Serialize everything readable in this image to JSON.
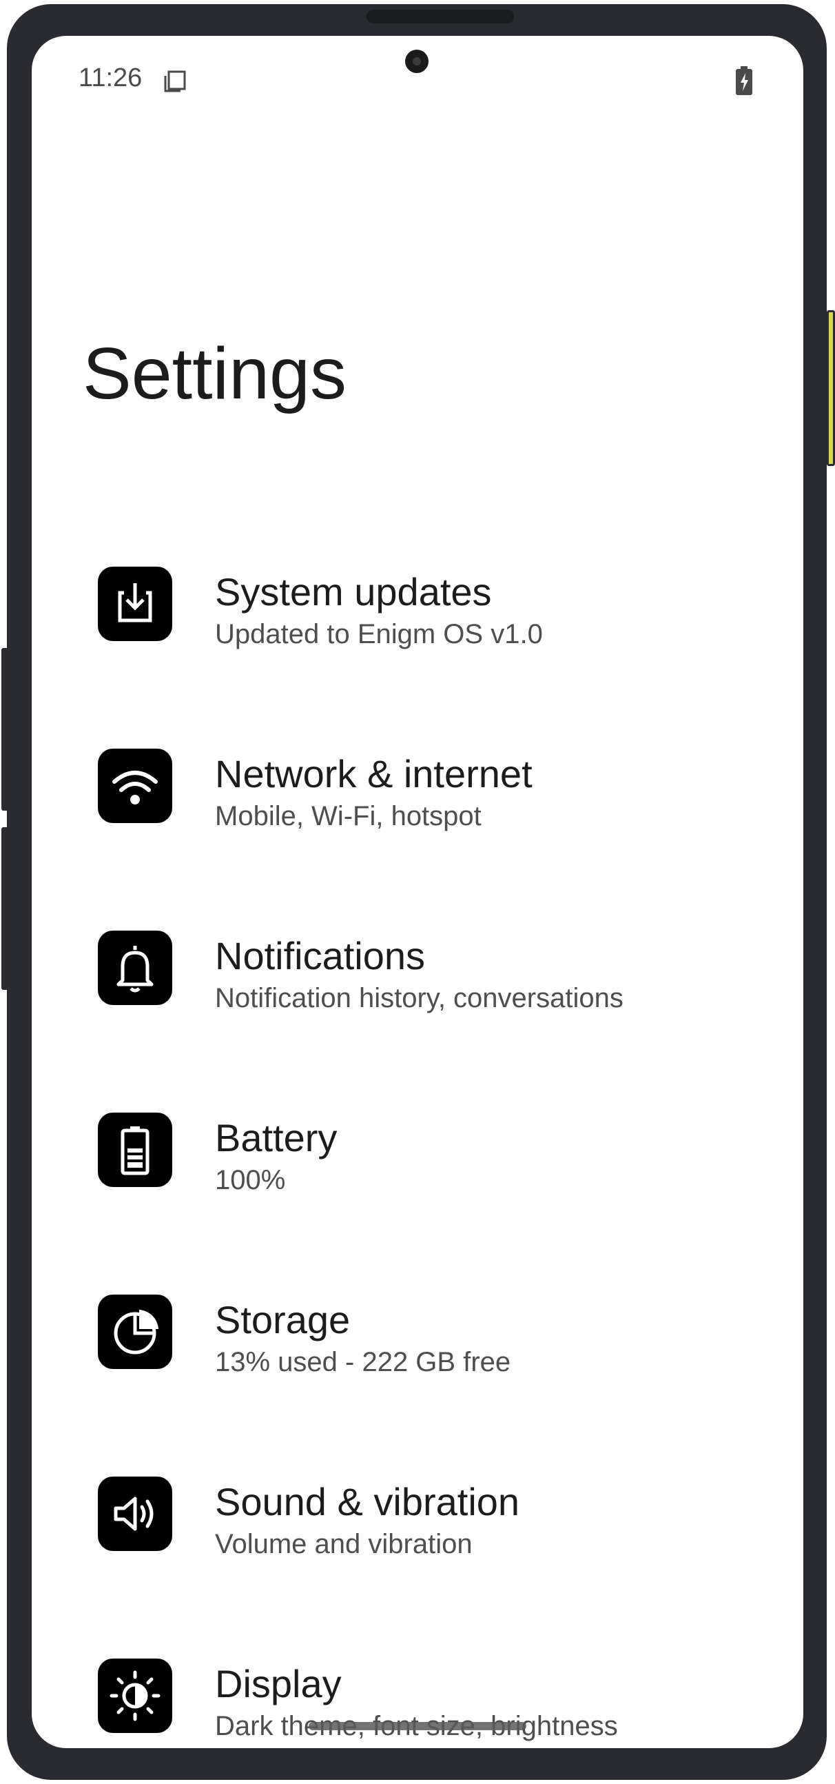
{
  "status_bar": {
    "time": "11:26",
    "notification_icon": "screenshot-notification-icon",
    "battery_icon": "battery-charging-icon"
  },
  "page": {
    "title": "Settings"
  },
  "settings": [
    {
      "icon": "system-update-icon",
      "title": "System updates",
      "subtitle": "Updated to Enigm OS v1.0"
    },
    {
      "icon": "wifi-icon",
      "title": "Network & internet",
      "subtitle": "Mobile, Wi-Fi, hotspot"
    },
    {
      "icon": "bell-icon",
      "title": "Notifications",
      "subtitle": "Notification history, conversations"
    },
    {
      "icon": "battery-icon",
      "title": "Battery",
      "subtitle": "100%"
    },
    {
      "icon": "storage-icon",
      "title": "Storage",
      "subtitle": "13% used - 222 GB free"
    },
    {
      "icon": "speaker-icon",
      "title": "Sound & vibration",
      "subtitle": "Volume and vibration"
    },
    {
      "icon": "brightness-icon",
      "title": "Display",
      "subtitle": "Dark theme, font size, brightness"
    }
  ],
  "colors": {
    "frame": "#2a2b30",
    "icon_tile": "#000000",
    "title_text": "#1c1c1c",
    "subtitle_text": "#4e4e4e"
  }
}
